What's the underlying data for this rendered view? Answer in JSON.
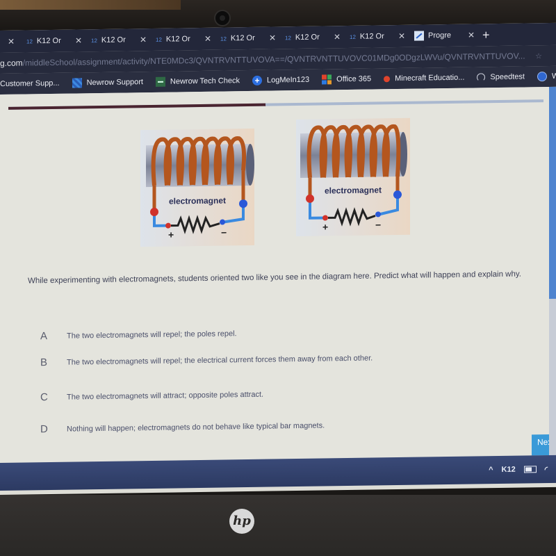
{
  "browser": {
    "tabs": [
      {
        "label": "",
        "icon": "close",
        "active": false
      },
      {
        "label": "K12 Or",
        "favicon": "12"
      },
      {
        "label": "K12 Or",
        "favicon": "12"
      },
      {
        "label": "K12 Or",
        "favicon": "12"
      },
      {
        "label": "K12 Or",
        "favicon": "12"
      },
      {
        "label": "K12 Or",
        "favicon": "12"
      },
      {
        "label": "K12 Or",
        "favicon": "12"
      },
      {
        "label": "Progre",
        "favicon": "progress-chart"
      }
    ],
    "close_glyph": "✕",
    "new_tab_glyph": "+",
    "url": {
      "host": "g.com",
      "path": "/middleSchool/assignment/activity/NTE0MDc3/QVNTRVNTTUVOVA==/QVNTRVNTTUVOVC01MDg0ODgzLWVu/QVNTRVNTTUVOV..."
    },
    "bookmarks": [
      {
        "label": "Customer Supp...",
        "icon": "none"
      },
      {
        "label": "Newrow Support",
        "icon": "newrow-icon"
      },
      {
        "label": "Newrow Tech Check",
        "icon": "tech-check-icon"
      },
      {
        "label": "LogMeIn123",
        "icon": "logmein-icon"
      },
      {
        "label": "Office 365",
        "icon": "office-icon"
      },
      {
        "label": "Minecraft Educatio...",
        "icon": "minecraft-icon"
      },
      {
        "label": "Speedtest",
        "icon": "speedtest-icon"
      },
      {
        "label": "What Is My Brow",
        "icon": "browser-icon"
      }
    ]
  },
  "assessment": {
    "progress_fraction": 0.48,
    "figures": [
      {
        "label": "electromagnet",
        "plus": "+",
        "minus": "−"
      },
      {
        "label": "electromagnet",
        "plus": "+",
        "minus": "−"
      }
    ],
    "question": "While experimenting with electromagnets, students oriented two like you see in the diagram here. Predict what will happen and explain why.",
    "choices": [
      {
        "letter": "A",
        "text": "The two electromagnets will repel; the poles repel."
      },
      {
        "letter": "B",
        "text": "The two electromagnets will repel; the electrical current forces them away from each other."
      },
      {
        "letter": "C",
        "text": "The two electromagnets will attract; opposite poles attract."
      },
      {
        "letter": "D",
        "text": "Nothing will happen; electromagnets do not behave like typical bar magnets."
      }
    ],
    "next_label": "Nex"
  },
  "taskbar": {
    "chevron": "^",
    "label": "K12"
  },
  "device": {
    "brand": "hp"
  },
  "colors": {
    "progress_fill": "#4a2430",
    "progress_track": "#aab8cf",
    "accent": "#3a9ad8"
  }
}
